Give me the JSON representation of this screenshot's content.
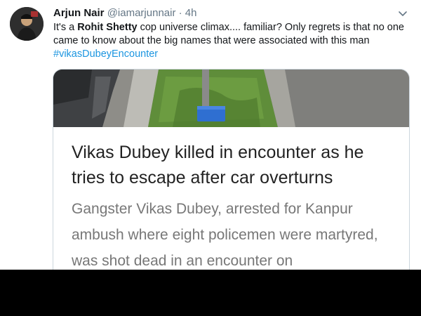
{
  "tweet": {
    "display_name": "Arjun Nair",
    "handle": "@iamarjunnair",
    "separator": "·",
    "time": "4h",
    "text_before": "It's a ",
    "text_bold": "Rohit Shetty",
    "text_after": " cop universe climax.... familiar? Only regrets is that no one came to know about the big names that were associated with this man",
    "hashtag": "#vikasDubeyEncounter"
  },
  "card": {
    "title": "Vikas Dubey killed in encounter as he tries to escape after car overturns",
    "description": "Gangster Vikas Dubey, arrested for Kanpur ambush where eight policemen were martyred, was shot dead in an encounter on"
  },
  "icons": {
    "menu": "chevron-down-icon",
    "avatar": "avatar"
  },
  "colors": {
    "link": "#1b95e0",
    "secondary_text": "#657786",
    "background_bottom": "#000000"
  }
}
